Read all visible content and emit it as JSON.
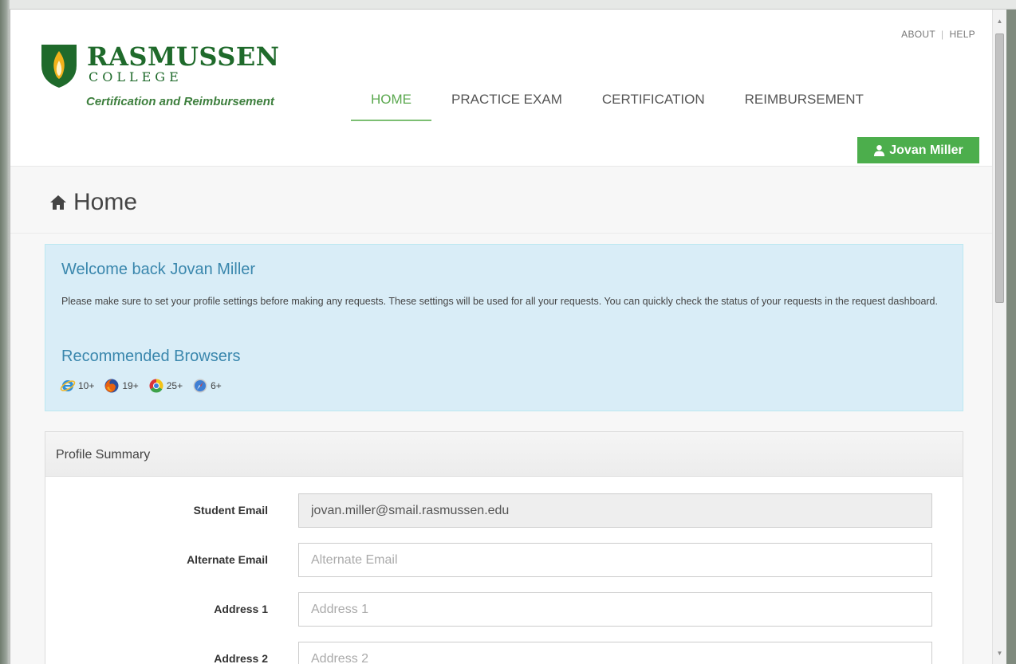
{
  "header": {
    "logo_name": "RASMUSSEN",
    "logo_sub": "COLLEGE",
    "tagline": "Certification and Reimbursement",
    "top_links": [
      "ABOUT",
      "HELP"
    ],
    "nav": [
      {
        "label": "HOME",
        "active": true
      },
      {
        "label": "PRACTICE EXAM",
        "active": false
      },
      {
        "label": "CERTIFICATION",
        "active": false
      },
      {
        "label": "REIMBURSEMENT",
        "active": false
      }
    ],
    "user_name": "Jovan Miller",
    "brand_color": "#1f6a2b",
    "accent_color": "#4cae4c"
  },
  "page": {
    "title": "Home",
    "title_icon": "home-icon"
  },
  "welcome": {
    "title": "Welcome back Jovan Miller",
    "text": "Please make sure to set your profile settings before making any requests. These settings will be used for all your requests. You can quickly check the status of your requests in the request dashboard.",
    "recommended_title": "Recommended Browsers",
    "browsers": [
      {
        "icon": "internet-explorer-icon",
        "version": "10+"
      },
      {
        "icon": "firefox-icon",
        "version": "19+"
      },
      {
        "icon": "chrome-icon",
        "version": "25+"
      },
      {
        "icon": "safari-icon",
        "version": "6+"
      }
    ]
  },
  "profile": {
    "heading": "Profile Summary",
    "fields": [
      {
        "label": "Student Email",
        "value": "jovan.miller@smail.rasmussen.edu",
        "placeholder": "",
        "readonly": true
      },
      {
        "label": "Alternate Email",
        "value": "",
        "placeholder": "Alternate Email",
        "readonly": false
      },
      {
        "label": "Address 1",
        "value": "",
        "placeholder": "Address 1",
        "readonly": false
      },
      {
        "label": "Address 2",
        "value": "",
        "placeholder": "Address 2",
        "readonly": false
      }
    ]
  }
}
